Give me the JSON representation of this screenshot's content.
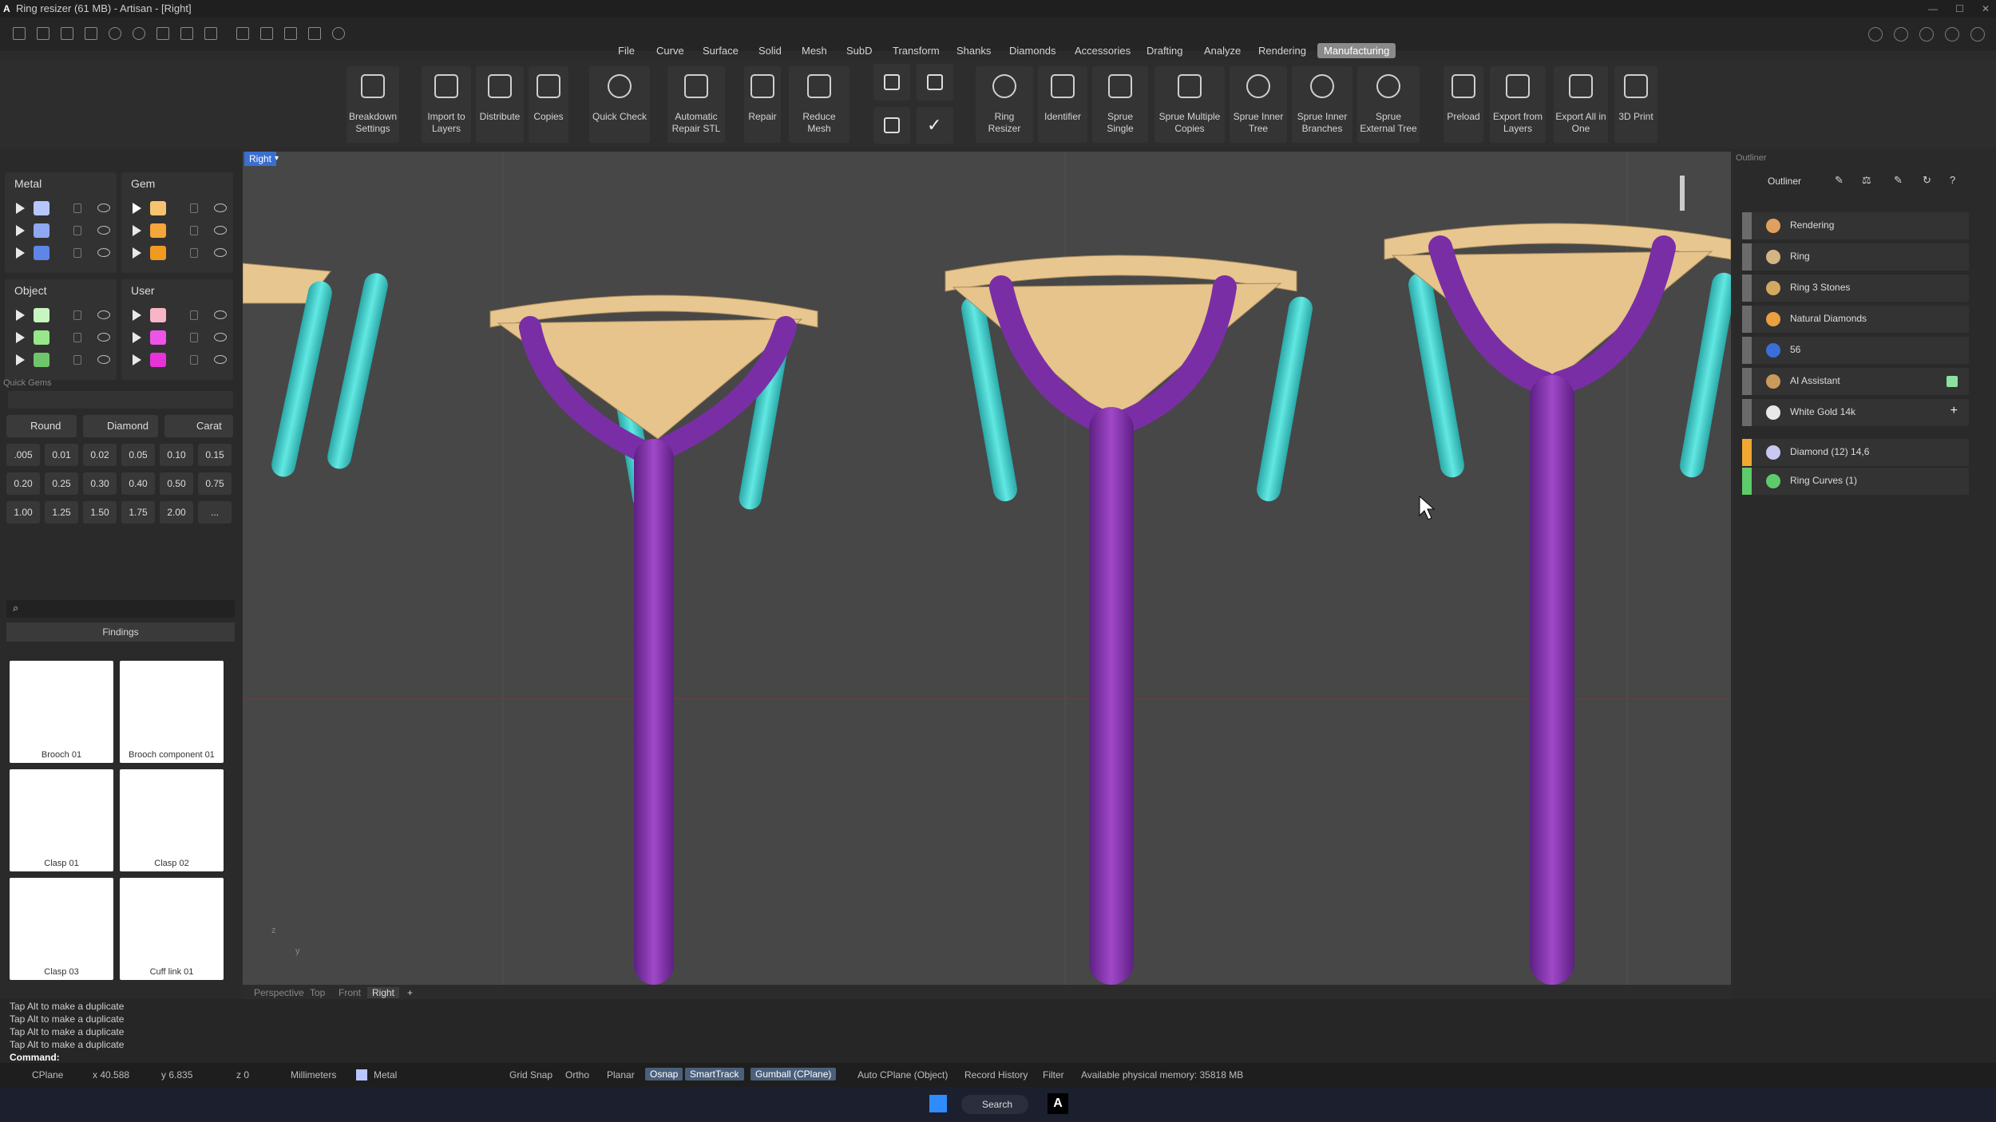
{
  "window": {
    "title": "Ring resizer (61 MB) - Artisan - [Right]"
  },
  "menu": [
    "File",
    "Curve",
    "Surface",
    "Solid",
    "Mesh",
    "SubD",
    "Transform",
    "Shanks",
    "Diamonds",
    "Accessories",
    "Drafting",
    "Analyze",
    "Rendering",
    "Manufacturing"
  ],
  "menu_active": "Manufacturing",
  "ribbon": [
    {
      "label": "Breakdown Settings",
      "icon": "breakdown-icon"
    },
    {
      "label": "Import to Layers",
      "icon": "import-layers-icon"
    },
    {
      "label": "Distribute",
      "icon": "distribute-icon"
    },
    {
      "label": "Copies",
      "icon": "copies-icon"
    },
    {
      "label": "Quick Check",
      "icon": "quick-check-icon"
    },
    {
      "label": "Automatic Repair STL",
      "icon": "auto-repair-icon"
    },
    {
      "label": "Repair",
      "icon": "repair-icon"
    },
    {
      "label": "Reduce Mesh",
      "icon": "reduce-mesh-icon"
    },
    {
      "label": "Ring Resizer",
      "icon": "ring-resizer-icon"
    },
    {
      "label": "Identifier",
      "icon": "identifier-icon"
    },
    {
      "label": "Sprue Single",
      "icon": "sprue-single-icon"
    },
    {
      "label": "Sprue Multiple Copies",
      "icon": "sprue-multiple-icon"
    },
    {
      "label": "Sprue Inner Tree",
      "icon": "sprue-inner-tree-icon"
    },
    {
      "label": "Sprue Inner Branches",
      "icon": "sprue-inner-branches-icon"
    },
    {
      "label": "Sprue External Tree",
      "icon": "sprue-external-tree-icon"
    },
    {
      "label": "Preload",
      "icon": "preload-icon"
    },
    {
      "label": "Export from Layers",
      "icon": "export-layers-icon"
    },
    {
      "label": "Export All in One",
      "icon": "export-all-icon"
    },
    {
      "label": "3D Print",
      "icon": "print-3d-icon"
    }
  ],
  "layers": {
    "metal": {
      "title": "Metal",
      "colors": [
        "#b7c6ff",
        "#8fa8f0",
        "#5e86e6"
      ]
    },
    "gem": {
      "title": "Gem",
      "colors": [
        "#f6c46e",
        "#f3a63a",
        "#f09a22"
      ]
    },
    "object": {
      "title": "Object",
      "colors": [
        "#c8f5c0",
        "#98e68a",
        "#6fc56a"
      ]
    },
    "user": {
      "title": "User",
      "colors": [
        "#f7b5c8",
        "#ee55e6",
        "#e632d8"
      ]
    }
  },
  "quick_gems": {
    "title": "Quick Gems",
    "shape": "Round",
    "type": "Diamond",
    "unit": "Carat",
    "sizes": [
      ".005",
      "0.01",
      "0.02",
      "0.05",
      "0.10",
      "0.15",
      "0.20",
      "0.25",
      "0.30",
      "0.40",
      "0.50",
      "0.75",
      "1.00",
      "1.25",
      "1.50",
      "1.75",
      "2.00",
      "..."
    ]
  },
  "library": {
    "category": "Findings",
    "items": [
      "Brooch 01",
      "Brooch component 01",
      "Clasp 01",
      "Clasp 02",
      "Clasp 03",
      "Cuff link 01"
    ]
  },
  "viewport": {
    "label": "Right",
    "tabs": [
      "Perspective",
      "Top",
      "Front",
      "Right"
    ],
    "active_tab": "Right",
    "axis_z": "z",
    "axis_y": "y"
  },
  "outliner": {
    "title": "Outliner",
    "panel_label": "Outliner",
    "rows": [
      {
        "label": "Rendering",
        "bar": "#6b6b6b",
        "icon": "#e0a060"
      },
      {
        "label": "Ring",
        "bar": "#6b6b6b",
        "icon": "#d4b483"
      },
      {
        "label": "Ring 3 Stones",
        "bar": "#6b6b6b",
        "icon": "#d4a860"
      },
      {
        "label": "Natural Diamonds",
        "bar": "#6b6b6b",
        "icon": "#e8a040"
      },
      {
        "label": "56",
        "bar": "#6b6b6b",
        "icon": "#3b6fd8"
      },
      {
        "label": "AI Assistant",
        "bar": "#6b6b6b",
        "icon": "#c99a5a"
      },
      {
        "label": "White Gold 14k",
        "bar": "#6b6b6b",
        "icon": "#e8e8e8"
      },
      {
        "label": "Diamond (12) 14,6",
        "bar": "#f0a830",
        "icon": "#c8c8f0"
      },
      {
        "label": "Ring Curves (1)",
        "bar": "#5ecb6a",
        "icon": "#5ecb6a"
      }
    ]
  },
  "command": {
    "history": [
      "Tap Alt to make a duplicate",
      "Tap Alt to make a duplicate",
      "Tap Alt to make a duplicate",
      "Tap Alt to make a duplicate"
    ],
    "prompt": "Command:"
  },
  "status": {
    "cplane": "CPlane",
    "x": "x 40.588",
    "y": "y 6.835",
    "z": "z 0",
    "units": "Millimeters",
    "layer": "Metal",
    "grid_snap": "Grid Snap",
    "ortho": "Ortho",
    "planar": "Planar",
    "osnap": "Osnap",
    "smarttrack": "SmartTrack",
    "gumball": "Gumball (CPlane)",
    "auto_cplane": "Auto CPlane (Object)",
    "record_history": "Record History",
    "filter": "Filter",
    "memory": "Available physical memory: 35818 MB"
  },
  "taskbar": {
    "search": "Search"
  },
  "colors": {
    "metal_shank": "#8a2fb0",
    "prong": "#3cd0c8",
    "gem": "#e8c690",
    "accent": "#4a78d0"
  }
}
